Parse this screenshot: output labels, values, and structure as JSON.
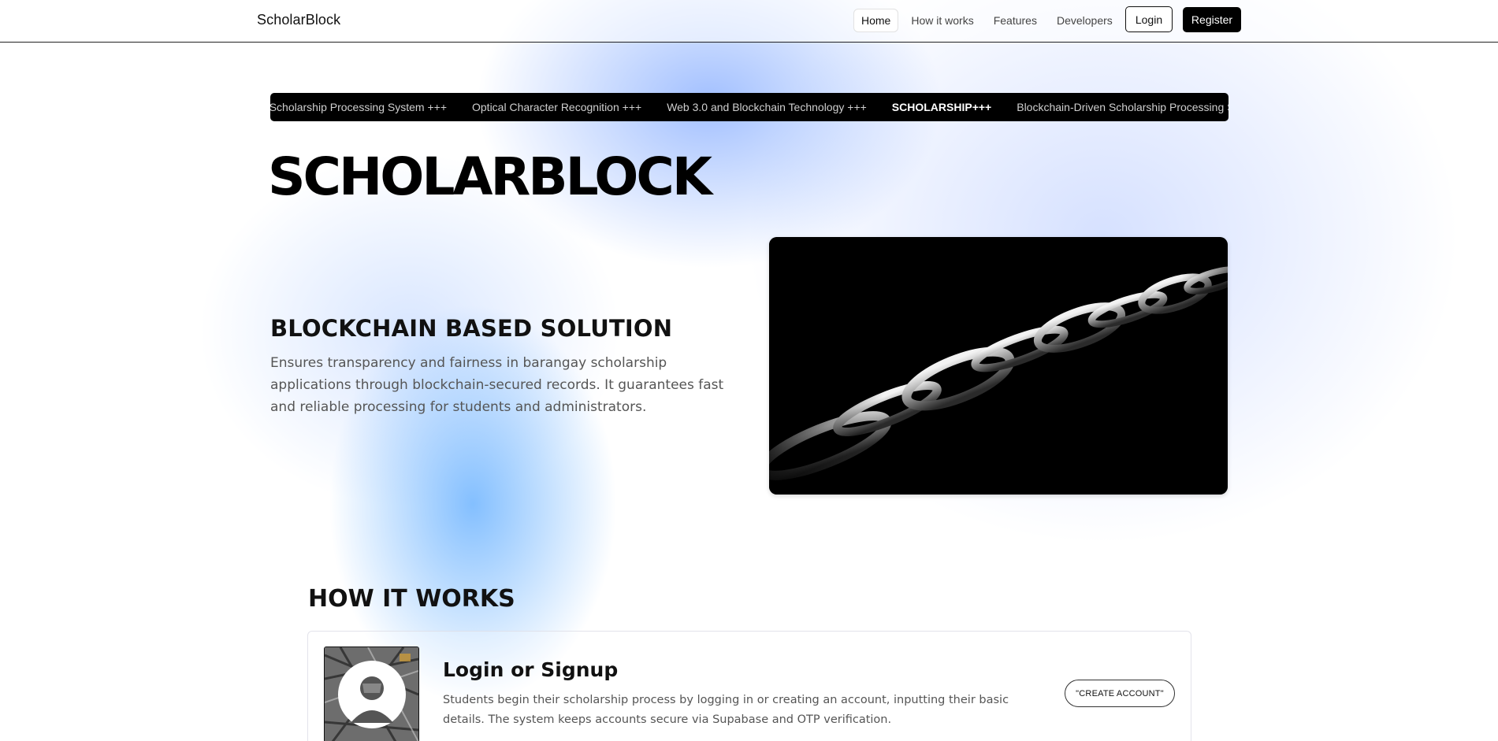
{
  "navbar": {
    "brand": "ScholarBlock",
    "links": [
      {
        "label": "Home",
        "active": true
      },
      {
        "label": "How it works",
        "active": false
      },
      {
        "label": "Features",
        "active": false
      },
      {
        "label": "Developers",
        "active": false
      }
    ],
    "login_label": "Login",
    "register_label": "Register"
  },
  "marquee": {
    "items": [
      "Blockchain-Driven Scholarship Processing System +++",
      "Optical Character Recognition +++",
      "Web 3.0 and Blockchain Technology +++",
      "SCHOLARSHIP+++",
      "Blockchain-Driven Scholarship Processing System +++"
    ]
  },
  "hero": {
    "title": "SCHOLARBLOCK",
    "heading": "BLOCKCHAIN BASED SOLUTION",
    "body": "Ensures transparency and fairness in barangay scholarship applications through blockchain-secured records. It guarantees fast and reliable processing for students and administrators.",
    "image": "chain-links-image"
  },
  "how_it_works": {
    "title": "HOW IT WORKS",
    "steps": [
      {
        "title": "Login or Signup",
        "description": "Students begin their scholarship process by logging in or creating an account, inputting their basic details. The system keeps accounts secure via Supabase and OTP verification.",
        "button_label": "\"CREATE ACCOUNT\"",
        "image": "user-avatar-icon"
      }
    ]
  },
  "colors": {
    "navbar_border": "#222222",
    "marquee_bg": "#000000",
    "register_bg": "#000000",
    "glow_blue": "#6eb4ff",
    "glow_lavender": "#b4c8ff"
  }
}
